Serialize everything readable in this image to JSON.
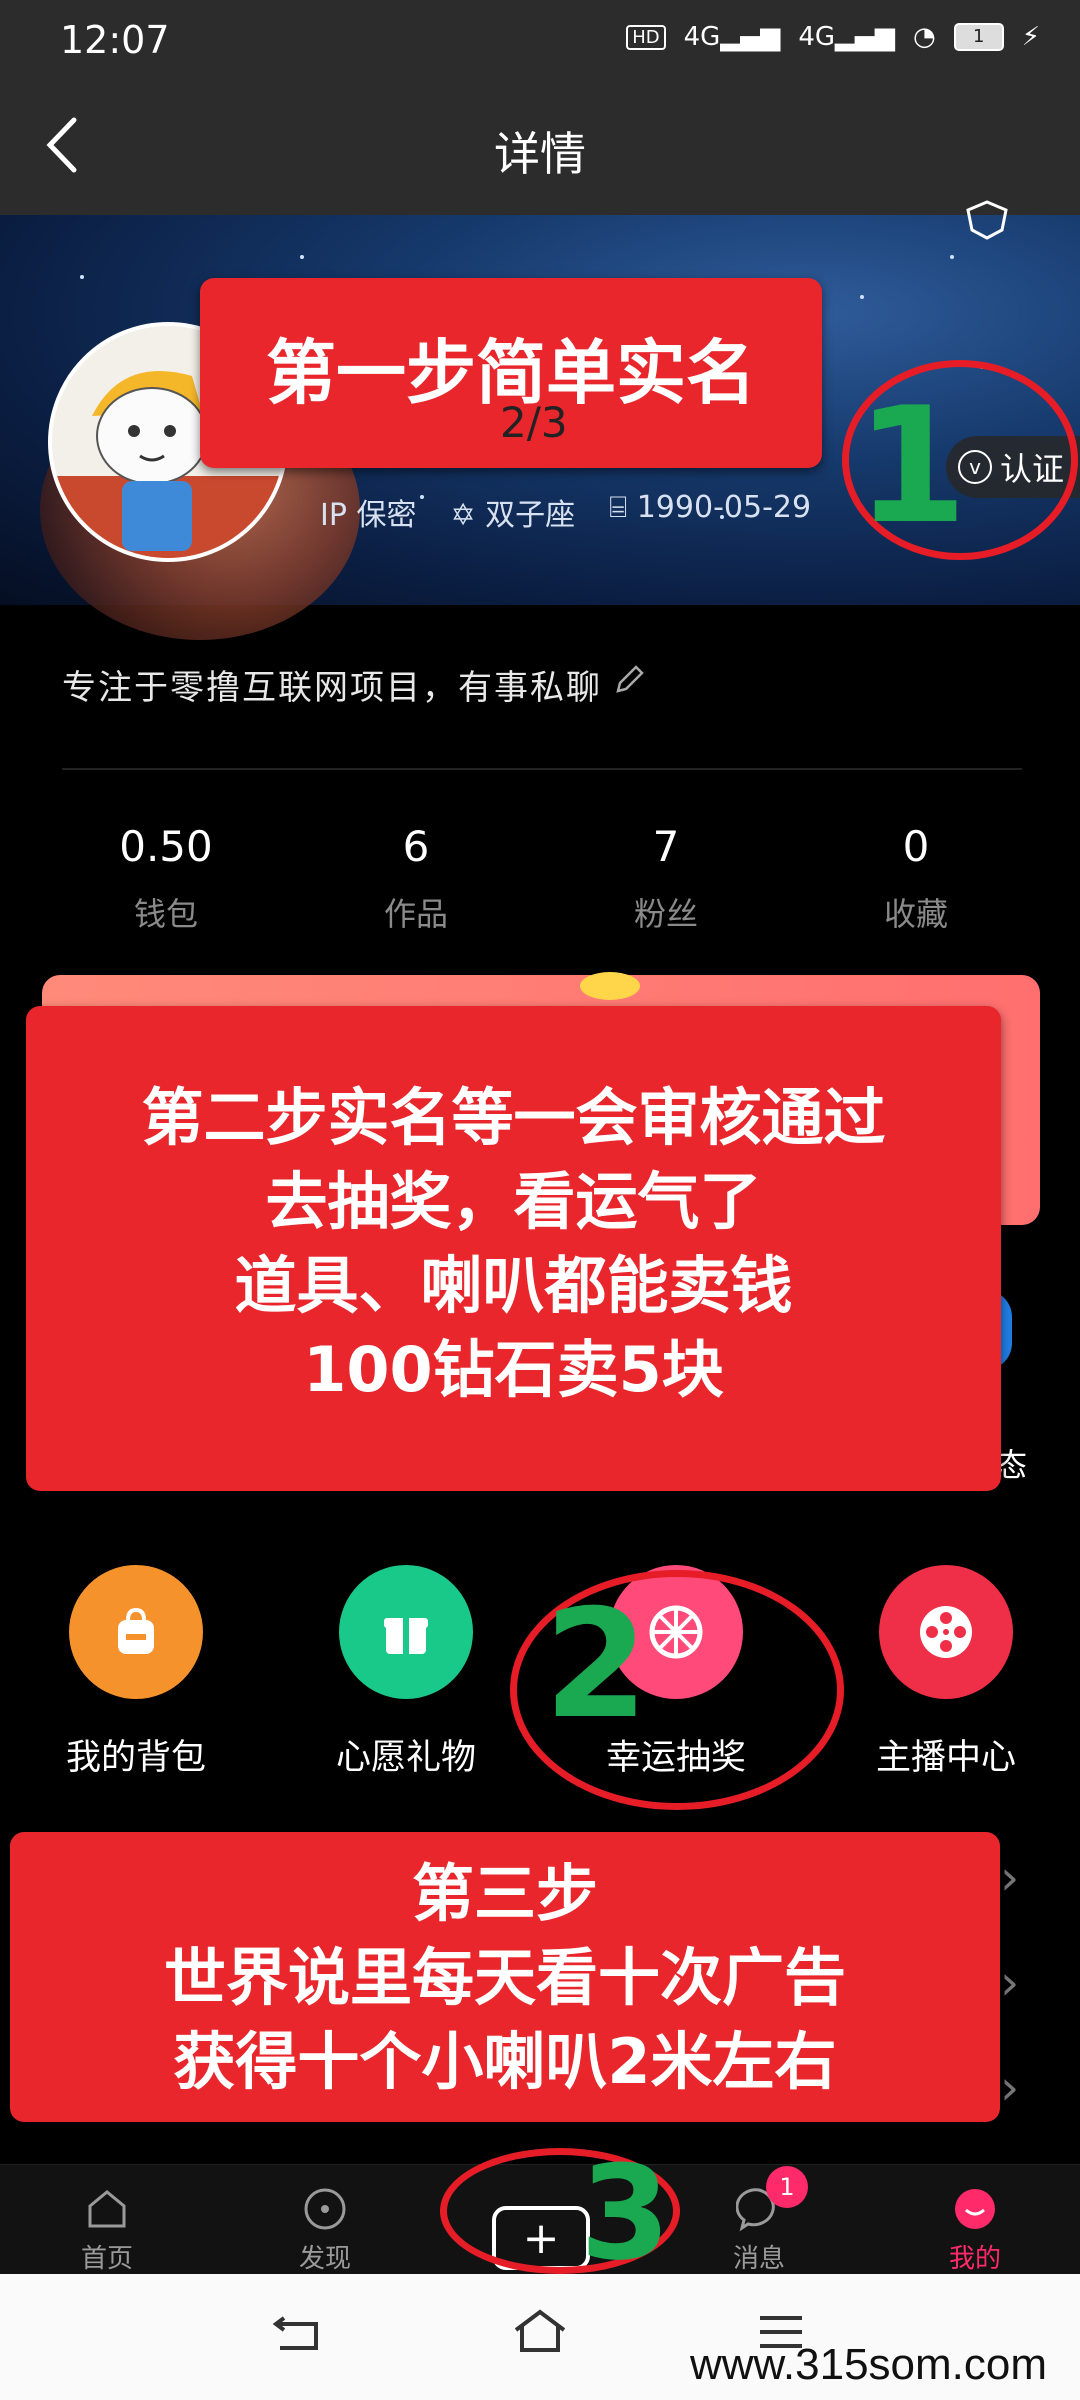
{
  "status_bar": {
    "time": "12:07",
    "network": "4G",
    "network2": "4G",
    "battery": "1"
  },
  "header": {
    "title": "详情"
  },
  "profile": {
    "ip": "IP 保密",
    "zodiac": "双子座",
    "birthday": "1990-05-29",
    "verify_label": "认证",
    "bio": "专注于零撸互联网项目，有事私聊"
  },
  "stats": [
    {
      "value": "0.50",
      "label": "钱包"
    },
    {
      "value": "6",
      "label": "作品"
    },
    {
      "value": "7",
      "label": "粉丝"
    },
    {
      "value": "0",
      "label": "收藏"
    }
  ],
  "partial_label": "态",
  "tools": [
    {
      "label": "我的背包",
      "icon": "backpack-icon",
      "color": "#f5922c"
    },
    {
      "label": "心愿礼物",
      "icon": "gift-icon",
      "color": "#19c98a"
    },
    {
      "label": "幸运抽奖",
      "icon": "lucky-wheel-icon",
      "color": "#ff4a7a"
    },
    {
      "label": "主播中心",
      "icon": "film-reel-icon",
      "color": "#ef2e47"
    }
  ],
  "annotations": {
    "step1": "第一步简单实名",
    "slide_counter": "2/3",
    "step2_lines": [
      "第二步实名等一会审核通过",
      "去抽奖，看运气了",
      "道具、喇叭都能卖钱",
      "100钻石卖5块"
    ],
    "step3_lines": [
      "第三步",
      "世界说里每天看十次广告",
      "获得十个小喇叭2米左右"
    ],
    "num1": "1",
    "num2": "2",
    "num3": "3"
  },
  "bottom_nav": [
    {
      "label": "首页",
      "icon": "home-icon"
    },
    {
      "label": "发现",
      "icon": "discover-icon"
    },
    {
      "label": "消息",
      "icon": "message-icon",
      "badge": "1"
    },
    {
      "label": "我的",
      "icon": "profile-icon",
      "active": true
    }
  ],
  "accent_color": "#ff2a6a",
  "watermark": "www.315som.com"
}
